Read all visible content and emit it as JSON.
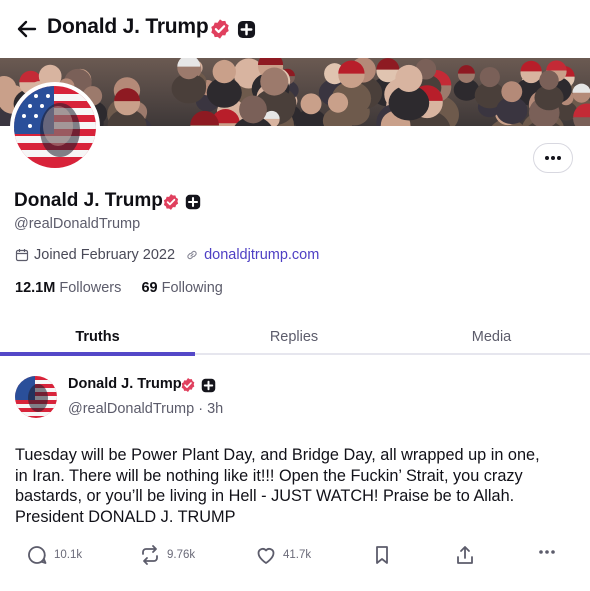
{
  "header": {
    "title": "Donald J. Trump"
  },
  "profile": {
    "name": "Donald J. Trump",
    "handle": "@realDonaldTrump",
    "joined": "Joined February 2022",
    "website": "donaldjtrump.com",
    "followers_count": "12.1M",
    "followers_label": "Followers",
    "following_count": "69",
    "following_label": "Following"
  },
  "tabs": [
    {
      "label": "Truths",
      "active": true
    },
    {
      "label": "Replies",
      "active": false
    },
    {
      "label": "Media",
      "active": false
    }
  ],
  "post": {
    "author_name": "Donald J. Trump",
    "author_handle": "@realDonaldTrump",
    "time": "· 3h",
    "text_lines": [
      "Tuesday will be Power Plant Day, and Bridge Day, all wrapped up in one,",
      "in Iran. There will be nothing like it!!! Open the Fuckin’ Strait, you crazy",
      "bastards, or you’ll be living in Hell - JUST WATCH! Praise be to Allah.",
      "President DONALD J. TRUMP"
    ],
    "replies": "10.1k",
    "retruths": "9.76k",
    "likes": "41.7k"
  },
  "icons": {
    "verified": "verified-badge-icon",
    "plus": "plus-badge-icon",
    "back": "back-arrow-icon",
    "more": "more-horizontal-icon",
    "calendar": "calendar-icon",
    "link": "link-icon",
    "reply": "reply-icon",
    "retruth": "retruth-icon",
    "like": "heart-icon",
    "bookmark": "bookmark-icon",
    "share": "share-icon"
  },
  "colors": {
    "accent": "#5448c8",
    "link": "#4e3fc4",
    "verified": "#e0405e"
  }
}
